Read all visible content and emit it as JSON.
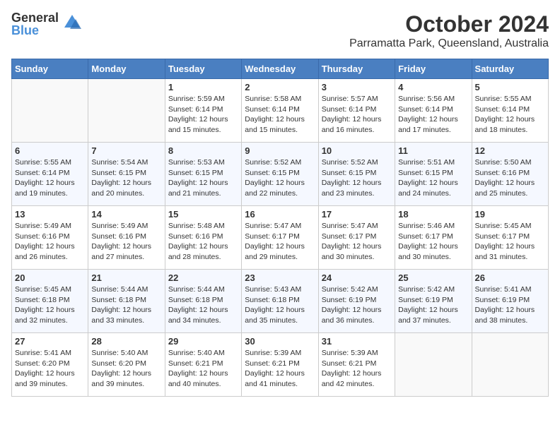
{
  "logo": {
    "general": "General",
    "blue": "Blue"
  },
  "title": "October 2024",
  "subtitle": "Parramatta Park, Queensland, Australia",
  "weekdays": [
    "Sunday",
    "Monday",
    "Tuesday",
    "Wednesday",
    "Thursday",
    "Friday",
    "Saturday"
  ],
  "weeks": [
    [
      {
        "day": "",
        "info": ""
      },
      {
        "day": "",
        "info": ""
      },
      {
        "day": "1",
        "info": "Sunrise: 5:59 AM\nSunset: 6:14 PM\nDaylight: 12 hours and 15 minutes."
      },
      {
        "day": "2",
        "info": "Sunrise: 5:58 AM\nSunset: 6:14 PM\nDaylight: 12 hours and 15 minutes."
      },
      {
        "day": "3",
        "info": "Sunrise: 5:57 AM\nSunset: 6:14 PM\nDaylight: 12 hours and 16 minutes."
      },
      {
        "day": "4",
        "info": "Sunrise: 5:56 AM\nSunset: 6:14 PM\nDaylight: 12 hours and 17 minutes."
      },
      {
        "day": "5",
        "info": "Sunrise: 5:55 AM\nSunset: 6:14 PM\nDaylight: 12 hours and 18 minutes."
      }
    ],
    [
      {
        "day": "6",
        "info": "Sunrise: 5:55 AM\nSunset: 6:14 PM\nDaylight: 12 hours and 19 minutes."
      },
      {
        "day": "7",
        "info": "Sunrise: 5:54 AM\nSunset: 6:15 PM\nDaylight: 12 hours and 20 minutes."
      },
      {
        "day": "8",
        "info": "Sunrise: 5:53 AM\nSunset: 6:15 PM\nDaylight: 12 hours and 21 minutes."
      },
      {
        "day": "9",
        "info": "Sunrise: 5:52 AM\nSunset: 6:15 PM\nDaylight: 12 hours and 22 minutes."
      },
      {
        "day": "10",
        "info": "Sunrise: 5:52 AM\nSunset: 6:15 PM\nDaylight: 12 hours and 23 minutes."
      },
      {
        "day": "11",
        "info": "Sunrise: 5:51 AM\nSunset: 6:15 PM\nDaylight: 12 hours and 24 minutes."
      },
      {
        "day": "12",
        "info": "Sunrise: 5:50 AM\nSunset: 6:16 PM\nDaylight: 12 hours and 25 minutes."
      }
    ],
    [
      {
        "day": "13",
        "info": "Sunrise: 5:49 AM\nSunset: 6:16 PM\nDaylight: 12 hours and 26 minutes."
      },
      {
        "day": "14",
        "info": "Sunrise: 5:49 AM\nSunset: 6:16 PM\nDaylight: 12 hours and 27 minutes."
      },
      {
        "day": "15",
        "info": "Sunrise: 5:48 AM\nSunset: 6:16 PM\nDaylight: 12 hours and 28 minutes."
      },
      {
        "day": "16",
        "info": "Sunrise: 5:47 AM\nSunset: 6:17 PM\nDaylight: 12 hours and 29 minutes."
      },
      {
        "day": "17",
        "info": "Sunrise: 5:47 AM\nSunset: 6:17 PM\nDaylight: 12 hours and 30 minutes."
      },
      {
        "day": "18",
        "info": "Sunrise: 5:46 AM\nSunset: 6:17 PM\nDaylight: 12 hours and 30 minutes."
      },
      {
        "day": "19",
        "info": "Sunrise: 5:45 AM\nSunset: 6:17 PM\nDaylight: 12 hours and 31 minutes."
      }
    ],
    [
      {
        "day": "20",
        "info": "Sunrise: 5:45 AM\nSunset: 6:18 PM\nDaylight: 12 hours and 32 minutes."
      },
      {
        "day": "21",
        "info": "Sunrise: 5:44 AM\nSunset: 6:18 PM\nDaylight: 12 hours and 33 minutes."
      },
      {
        "day": "22",
        "info": "Sunrise: 5:44 AM\nSunset: 6:18 PM\nDaylight: 12 hours and 34 minutes."
      },
      {
        "day": "23",
        "info": "Sunrise: 5:43 AM\nSunset: 6:18 PM\nDaylight: 12 hours and 35 minutes."
      },
      {
        "day": "24",
        "info": "Sunrise: 5:42 AM\nSunset: 6:19 PM\nDaylight: 12 hours and 36 minutes."
      },
      {
        "day": "25",
        "info": "Sunrise: 5:42 AM\nSunset: 6:19 PM\nDaylight: 12 hours and 37 minutes."
      },
      {
        "day": "26",
        "info": "Sunrise: 5:41 AM\nSunset: 6:19 PM\nDaylight: 12 hours and 38 minutes."
      }
    ],
    [
      {
        "day": "27",
        "info": "Sunrise: 5:41 AM\nSunset: 6:20 PM\nDaylight: 12 hours and 39 minutes."
      },
      {
        "day": "28",
        "info": "Sunrise: 5:40 AM\nSunset: 6:20 PM\nDaylight: 12 hours and 39 minutes."
      },
      {
        "day": "29",
        "info": "Sunrise: 5:40 AM\nSunset: 6:21 PM\nDaylight: 12 hours and 40 minutes."
      },
      {
        "day": "30",
        "info": "Sunrise: 5:39 AM\nSunset: 6:21 PM\nDaylight: 12 hours and 41 minutes."
      },
      {
        "day": "31",
        "info": "Sunrise: 5:39 AM\nSunset: 6:21 PM\nDaylight: 12 hours and 42 minutes."
      },
      {
        "day": "",
        "info": ""
      },
      {
        "day": "",
        "info": ""
      }
    ]
  ]
}
